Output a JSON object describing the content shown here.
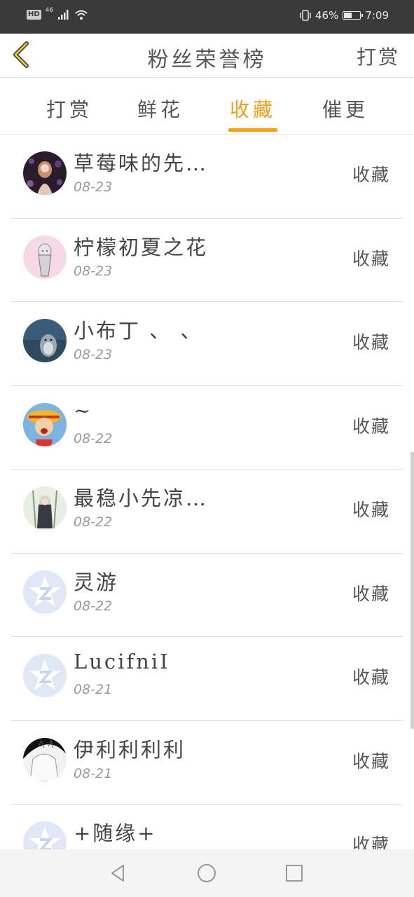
{
  "status": {
    "hd": "HD",
    "network": "46",
    "battery_percent": "46%",
    "time": "7:09",
    "battery_level": 0.45
  },
  "header": {
    "title": "粉丝荣誉榜",
    "action_label": "打赏",
    "back_icon": "chevron-left-icon",
    "accent_color": "#f0a01a"
  },
  "tabs": [
    {
      "label": "打赏",
      "active": false
    },
    {
      "label": "鲜花",
      "active": false
    },
    {
      "label": "收藏",
      "active": true
    },
    {
      "label": "催更",
      "active": false
    }
  ],
  "list": [
    {
      "name": "草莓味的先…",
      "date": "08-23",
      "action": "收藏",
      "avatar": "anime-girl-purple"
    },
    {
      "name": "柠檬初夏之花",
      "date": "08-23",
      "action": "收藏",
      "avatar": "anime-pink"
    },
    {
      "name": "小布丁 、 、",
      "date": "08-23",
      "action": "收藏",
      "avatar": "totoro-blue"
    },
    {
      "name": "~",
      "date": "08-22",
      "action": "收藏",
      "avatar": "luffy"
    },
    {
      "name": "最稳小先凉…",
      "date": "08-22",
      "action": "收藏",
      "avatar": "anime-dark"
    },
    {
      "name": "灵游",
      "date": "08-22",
      "action": "收藏",
      "avatar": "default-qzone"
    },
    {
      "name": "LucifniI",
      "date": "08-21",
      "action": "收藏",
      "avatar": "default-qzone"
    },
    {
      "name": "伊利利利利",
      "date": "08-21",
      "action": "收藏",
      "avatar": "sketch-girl"
    },
    {
      "name": "+随缘+",
      "date": "",
      "action": "收藏",
      "avatar": "default-qzone"
    }
  ],
  "navbar": {
    "back": "triangle-back-icon",
    "home": "circle-home-icon",
    "recent": "square-recent-icon"
  }
}
